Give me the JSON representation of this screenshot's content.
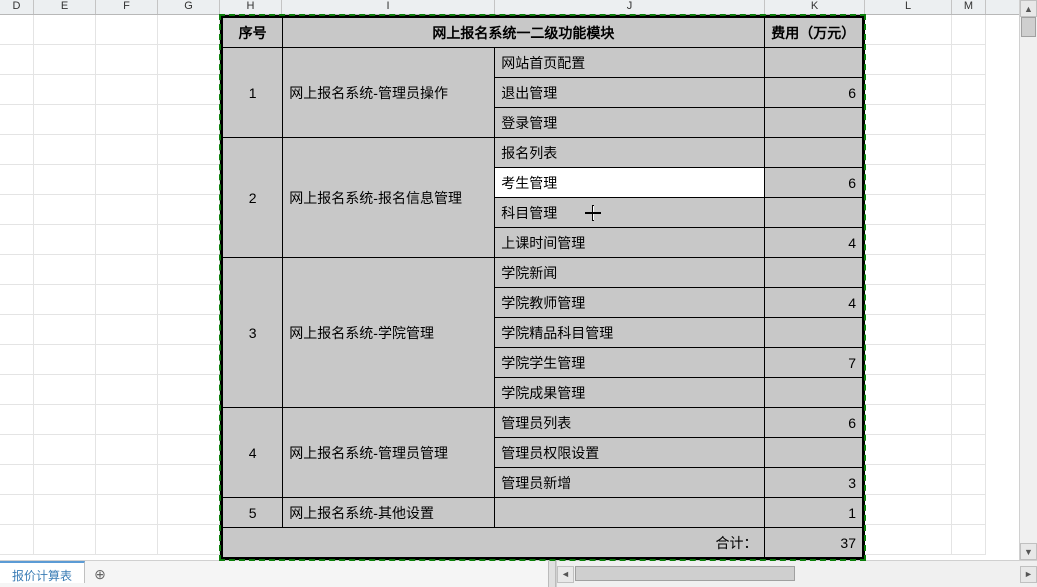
{
  "columns": {
    "D": "D",
    "E": "E",
    "F": "F",
    "G": "G",
    "H": "H",
    "I": "I",
    "J": "J",
    "K": "K",
    "L": "L",
    "M": "M"
  },
  "sheet": {
    "tab": "报价计算表"
  },
  "table": {
    "headers": {
      "seq": "序号",
      "modules_title": "网上报名系统一二级功能模块",
      "cost": "费用（万元）"
    },
    "groups": [
      {
        "seq": "1",
        "name": "网上报名系统-管理员操作",
        "items": [
          "网站首页配置",
          "退出管理",
          "登录管理"
        ],
        "costs": [
          "",
          "6",
          ""
        ]
      },
      {
        "seq": "2",
        "name": "网上报名系统-报名信息管理",
        "items": [
          "报名列表",
          "考生管理",
          "科目管理",
          "上课时间管理"
        ],
        "costs": [
          "",
          "6",
          "",
          "4"
        ]
      },
      {
        "seq": "3",
        "name": "网上报名系统-学院管理",
        "items": [
          "学院新闻",
          "学院教师管理",
          "学院精品科目管理",
          "学院学生管理",
          "学院成果管理"
        ],
        "costs": [
          "",
          "4",
          "",
          "7",
          ""
        ]
      },
      {
        "seq": "4",
        "name": "网上报名系统-管理员管理",
        "items": [
          "管理员列表",
          "管理员权限设置",
          "管理员新增"
        ],
        "costs": [
          "6",
          "",
          "3"
        ]
      },
      {
        "seq": "5",
        "name": "网上报名系统-其他设置",
        "items": [
          ""
        ],
        "costs": [
          "1"
        ]
      }
    ],
    "total_label": "合计：",
    "total_value": "37"
  },
  "active_cell_value": "考生管理"
}
